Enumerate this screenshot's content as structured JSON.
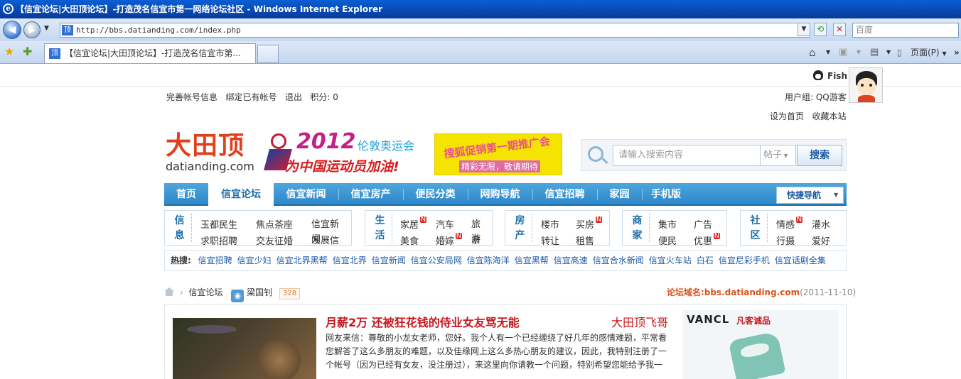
{
  "window": {
    "title": "【信宜论坛|大田顶论坛】-打造茂名信宜市第一网络论坛社区 - Windows Internet Explorer"
  },
  "browser": {
    "url": "http://bbs.datianding.com/index.php",
    "search_placeholder": "百度",
    "tab_title": "【信宜论坛|大田顶论坛】-打造茂名信宜市第...",
    "page_menu": "页面(P)"
  },
  "user": {
    "name": "Fish",
    "links": [
      "完善帐号信息",
      "绑定已有帐号",
      "退出"
    ],
    "points": "积分: 0",
    "group": "用户组: QQ游客",
    "set_home": "设为首页",
    "bookmark": "收藏本站"
  },
  "logo": {
    "name": "大田顶",
    "domain": "datianding.com"
  },
  "olympics": {
    "year": "2012",
    "sub": "伦敦奥运会",
    "slogan": "为中国运动员加油!"
  },
  "ad": {
    "line1": "搜狐促销第一期推广会",
    "line2": "精彩无限，敬请期待"
  },
  "site_search": {
    "placeholder": "请输入搜索内容",
    "type": "帖子",
    "button": "搜索"
  },
  "nav": {
    "items": [
      "首页",
      "信宜论坛",
      "信宜新闻",
      "信宜房产",
      "便民分类",
      "网购导航",
      "信宜招聘",
      "家园",
      "手机版"
    ],
    "active": 1,
    "quick": "快捷导航"
  },
  "categories": [
    {
      "head": [
        "信",
        "息"
      ],
      "links": [
        "玉都民生",
        "焦点茶座",
        "信宜新闻",
        "求职招聘",
        "交友征婚",
        "发展信宜"
      ]
    },
    {
      "head": [
        "生",
        "活"
      ],
      "links": [
        "家居",
        "汽车",
        "旅游",
        "美食",
        "婚嫁",
        "亲子"
      ]
    },
    {
      "head": [
        "房",
        "产"
      ],
      "links": [
        "楼市",
        "买房",
        "转让",
        "租售"
      ]
    },
    {
      "head": [
        "商",
        "家"
      ],
      "links": [
        "集市",
        "广告",
        "便民",
        "优惠"
      ]
    },
    {
      "head": [
        "社",
        "区"
      ],
      "links": [
        "情感",
        "灌水",
        "行摄",
        "爱好"
      ]
    }
  ],
  "hot": {
    "label": "热搜:",
    "links": [
      "信宜招聘",
      "信宜少妇",
      "信宜北界黑帮",
      "信宜北界",
      "信宜新闻",
      "信宜公安局网",
      "信宜陈海洋",
      "信宜黑帮",
      "信宜高速",
      "信宜合水新闻",
      "信宜火车站",
      "白石",
      "信宜尼彩手机",
      "信宜话剧全集"
    ]
  },
  "breadcrumb": {
    "forum": "信宜论坛",
    "moderator": "梁国钊",
    "count": "328"
  },
  "domain_note": {
    "label": "论坛域名:bbs.datianding.com",
    "date": "(2011-11-10)"
  },
  "featured": {
    "title": "月薪2万 还被狂花钱的侍业女友骂无能",
    "author": "大田顶飞哥",
    "text": "网友来信：尊敬的小龙女老师，您好。我个人有一个已经缠绕了好几年的感情难题，平常看您解答了这么多朋友的难题，以及佳缘网上这么多热心朋友的建议，因此，我特别注册了一个帐号（因为已经有女友，没注册过），来这里向你请教一个问题，特别希望您能给予我一"
  },
  "side_ad": {
    "brand": "VANCL",
    "cn": "凡客诚品"
  },
  "colors": {
    "nav": "#2d86c8",
    "link": "#1d5aa6",
    "accent": "#d9531e",
    "title_red": "#c8161d"
  }
}
